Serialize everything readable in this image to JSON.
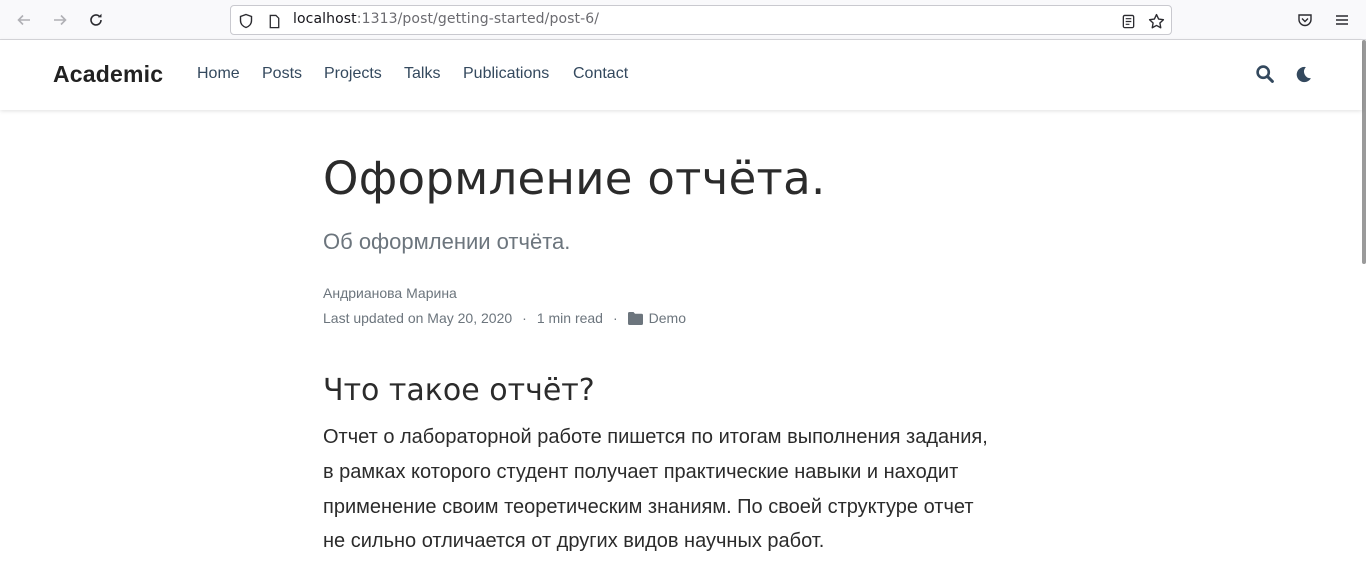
{
  "browser": {
    "url_host": "localhost",
    "url_path": ":1313/post/getting-started/post-6/",
    "icons": [
      "back-arrow-icon",
      "forward-arrow-icon",
      "reload-icon",
      "shield-icon",
      "page-icon",
      "reader-view-icon",
      "bookmark-star-icon",
      "pocket-icon",
      "menu-icon"
    ]
  },
  "site": {
    "brand": "Academic",
    "nav": [
      "Home",
      "Posts",
      "Projects",
      "Talks",
      "Publications",
      "Contact"
    ],
    "icons": [
      "search-icon",
      "dark-mode-moon-icon"
    ],
    "link_color": "#34495e"
  },
  "article": {
    "title": "Оформление отчёта.",
    "subtitle": "Об оформлении отчёта.",
    "author": "Андрианова Марина",
    "updated": "Last updated on May 20, 2020",
    "read_time": "1 min read",
    "category": "Demo",
    "separator": "·",
    "section_heading": "Что такое отчёт?",
    "paragraph_lines": [
      "Отчет о лабораторной работе пишется по итогам выполнения задания,",
      "в рамках которого студент получает практические навыки и находит",
      "применение своим теоретическим знаниям. По своей структуре отчет",
      "не сильно отличается от других видов научных работ."
    ]
  }
}
